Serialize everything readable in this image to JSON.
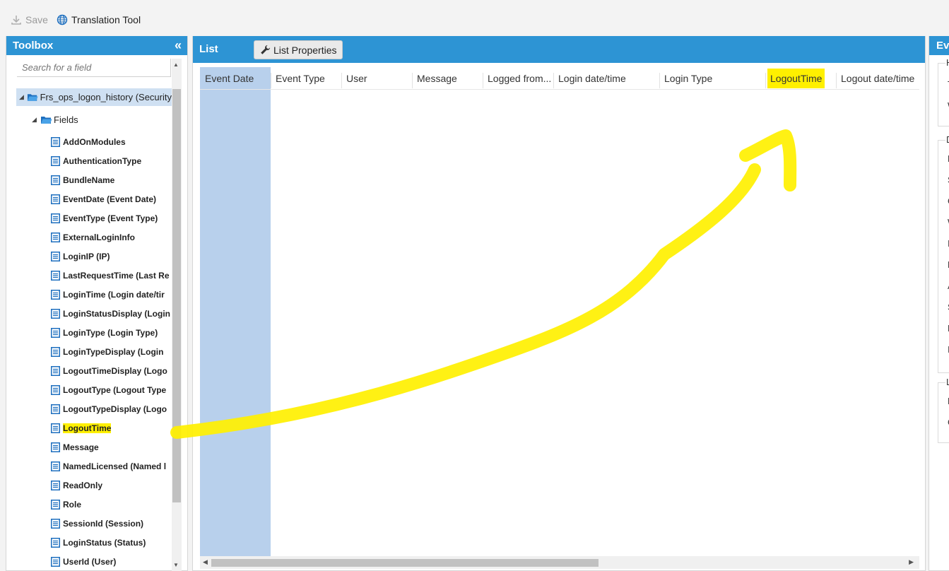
{
  "toolbar": {
    "save_label": "Save",
    "translation_label": "Translation Tool"
  },
  "toolbox": {
    "title": "Toolbox",
    "search_placeholder": "Search for a field",
    "root_label": "Frs_ops_logon_history (Security",
    "fields_label": "Fields",
    "fields": [
      "AddOnModules",
      "AuthenticationType",
      "BundleName",
      "EventDate (Event Date)",
      "EventType (Event Type)",
      "ExternalLoginInfo",
      "LoginIP (IP)",
      "LastRequestTime (Last Re",
      "LoginTime (Login date/tir",
      "LoginStatusDisplay (Login",
      "LoginType (Login Type)",
      "LoginTypeDisplay (Login",
      "LogoutTimeDisplay (Logo",
      "LogoutType (Logout Type",
      "LogoutTypeDisplay (Logo",
      "LogoutTime",
      "Message",
      "NamedLicensed (Named l",
      "ReadOnly",
      "Role",
      "SessionId (Session)",
      "LoginStatus (Status)",
      "UserId (User)"
    ],
    "highlighted_field": "LogoutTime"
  },
  "list": {
    "title": "List",
    "properties_label": "List Properties",
    "columns": [
      "Event Date",
      "Event Type",
      "User",
      "Message",
      "Logged from...",
      "Login date/time",
      "Login Type",
      "LogoutTime",
      "Logout date/time"
    ],
    "selected_column": "Event Date",
    "highlighted_column": "LogoutTime"
  },
  "right_panel": {
    "title": "Ev",
    "group1_legend": "H",
    "group1_lines": [
      "T",
      "W"
    ],
    "group2_legend": "D",
    "group2_lines": [
      "F",
      "S",
      "G",
      "W",
      "Ir",
      "H",
      "A",
      "S",
      "R",
      "Ir"
    ],
    "group3_legend": "L",
    "group3_lines": [
      "H",
      "G"
    ]
  },
  "colors": {
    "header_blue": "#2d94d4",
    "selection_blue": "#b8d0ec",
    "highlight_yellow": "#fff000",
    "icon_blue": "#1e6fbf"
  }
}
